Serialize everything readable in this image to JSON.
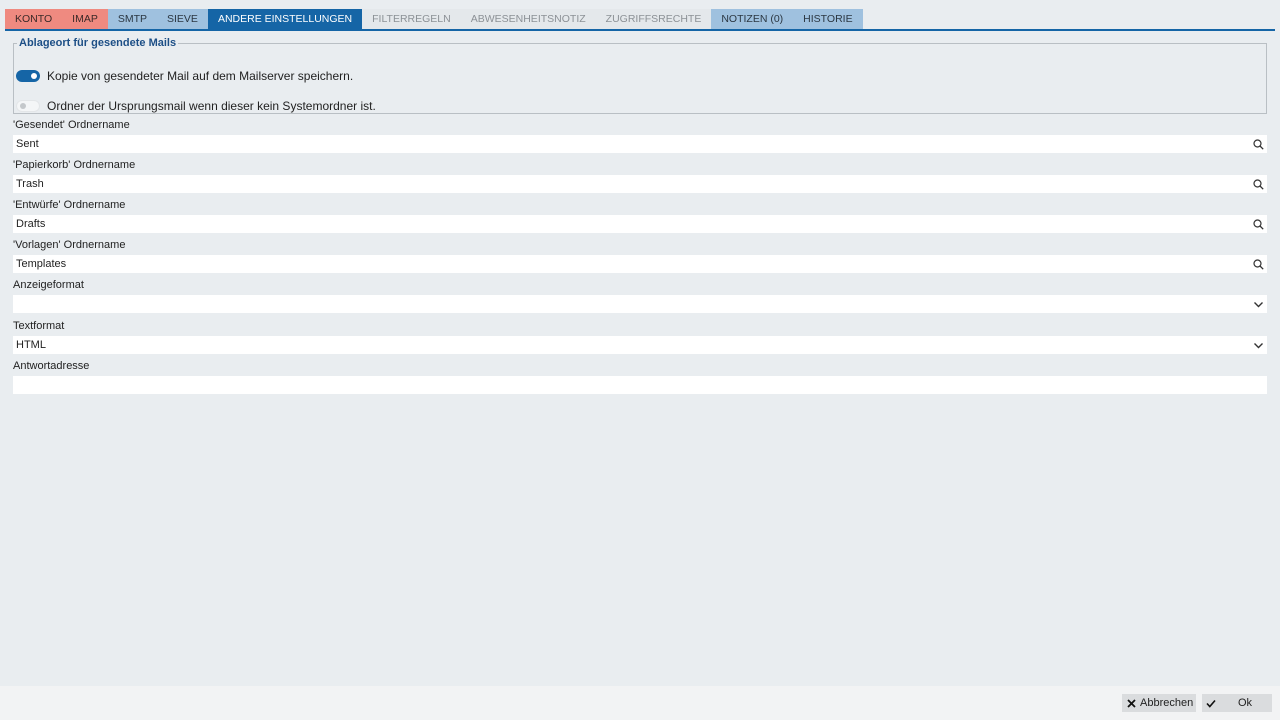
{
  "tabs": [
    {
      "label": "KONTO",
      "style": "red"
    },
    {
      "label": "IMAP",
      "style": "red"
    },
    {
      "label": "SMTP",
      "style": "blue"
    },
    {
      "label": "SIEVE",
      "style": "blue"
    },
    {
      "label": "ANDERE EINSTELLUNGEN",
      "style": "active"
    },
    {
      "label": "FILTERREGELN",
      "style": "grey"
    },
    {
      "label": "ABWESENHEITSNOTIZ",
      "style": "grey"
    },
    {
      "label": "ZUGRIFFSRECHTE",
      "style": "grey"
    },
    {
      "label": "NOTIZEN (0)",
      "style": "blue"
    },
    {
      "label": "HISTORIE",
      "style": "blue"
    }
  ],
  "sent_group": {
    "legend": "Ablageort für gesendete Mails",
    "save_copy": {
      "label": "Kopie von gesendeter Mail auf dem Mailserver speichern.",
      "checked": true
    },
    "origin_folder": {
      "label": "Ordner der Ursprungsmail wenn dieser kein Systemordner ist.",
      "checked": false
    }
  },
  "fields": {
    "sent": {
      "label": "'Gesendet' Ordnername",
      "value": "Sent",
      "icon": "search-icon"
    },
    "trash": {
      "label": "'Papierkorb' Ordnername",
      "value": "Trash",
      "icon": "search-icon"
    },
    "drafts": {
      "label": "'Entwürfe' Ordnername",
      "value": "Drafts",
      "icon": "search-icon"
    },
    "templates": {
      "label": "'Vorlagen' Ordnername",
      "value": "Templates",
      "icon": "search-icon"
    },
    "display_format": {
      "label": "Anzeigeformat",
      "value": "",
      "icon": "chevron-down-icon"
    },
    "text_format": {
      "label": "Textformat",
      "value": "HTML",
      "icon": "chevron-down-icon"
    },
    "reply_address": {
      "label": "Antwortadresse",
      "value": ""
    }
  },
  "footer": {
    "cancel_label": "Abbrechen",
    "ok_label": "Ok"
  },
  "colors": {
    "accent": "#1565a6",
    "tab_red": "#ef8a80",
    "tab_blue": "#9fc1df",
    "background": "#e9edf0"
  }
}
